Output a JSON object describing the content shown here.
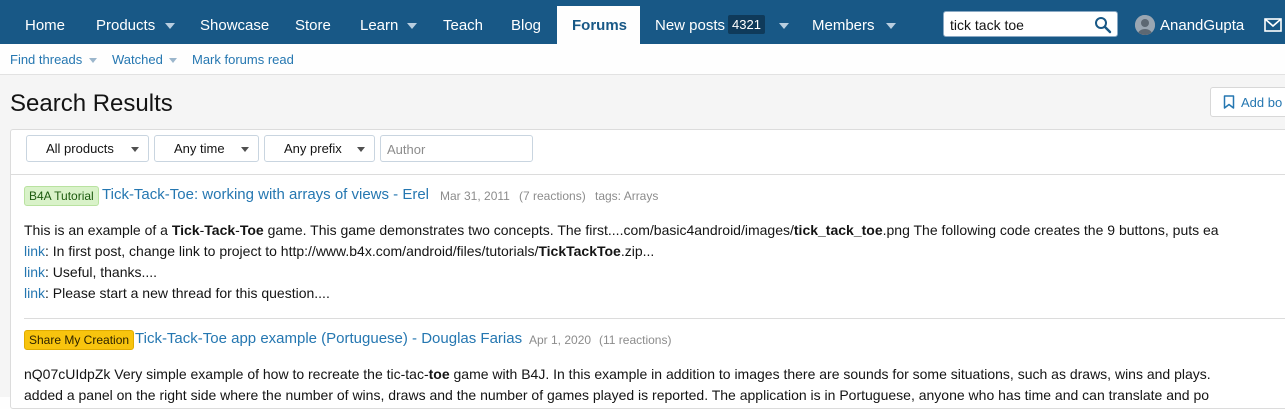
{
  "nav": {
    "items": [
      {
        "label": "Home"
      },
      {
        "label": "Products"
      },
      {
        "label": "Showcase"
      },
      {
        "label": "Store"
      },
      {
        "label": "Learn"
      },
      {
        "label": "Teach"
      },
      {
        "label": "Blog"
      },
      {
        "label": "Forums"
      },
      {
        "label": "New posts"
      },
      {
        "label": "Members"
      }
    ],
    "new_posts_count": "4321",
    "search_value": "tick tack toe",
    "user_name": "AnandGupta"
  },
  "subnav": {
    "find_threads": "Find threads",
    "watched": "Watched",
    "mark_read": "Mark forums read"
  },
  "page": {
    "title": "Search Results",
    "add_bookmark": "Add bo"
  },
  "filters": {
    "products": "All products",
    "time": "Any time",
    "prefix": "Any prefix",
    "author_placeholder": "Author"
  },
  "results": [
    {
      "prefix": "B4A Tutorial",
      "title": "Tick-Tack-Toe: working with arrays of views - Erel",
      "date": "Mar 31, 2011",
      "reactions": "(7 reactions)",
      "tags": "tags: Arrays",
      "snippet": {
        "p1": "This is an example of a ",
        "b1": "Tick",
        "p2": "-",
        "b2": "Tack",
        "p3": "-",
        "b3": "Toe",
        "p4": " game. This game demonstrates two concepts. The first....com/basic4android/images/",
        "b4": "tick_tack_toe",
        "p5": ".png The following code creates the 9 buttons, puts ea"
      },
      "links": [
        {
          "link": "link",
          "pre": ": In first post, change link to project to http://www.b4x.com/android/files/tutorials/",
          "bold": "TickTackToe",
          "post": ".zip..."
        },
        {
          "link": "link",
          "pre": ": Useful, thanks....",
          "bold": "",
          "post": ""
        },
        {
          "link": "link",
          "pre": ": Please start a new thread for this question....",
          "bold": "",
          "post": ""
        }
      ]
    },
    {
      "prefix": "Share My Creation",
      "title": "Tick-Tack-Toe app example (Portuguese) - Douglas Farias",
      "date": "Apr 1, 2020",
      "reactions": "(11 reactions)",
      "snippet": {
        "p1": "nQ07cUIdpZk Very simple example of how to recreate the tic-tac-",
        "b1": "toe",
        "p2": " game with B4J. In this example in addition to images there are sounds for some situations, such as draws, wins and plays. "
      },
      "line2": "added a panel on the right side where the number of wins, draws and the number of games played is reported. The application is in Portuguese, anyone who has time and can translate and po"
    }
  ]
}
